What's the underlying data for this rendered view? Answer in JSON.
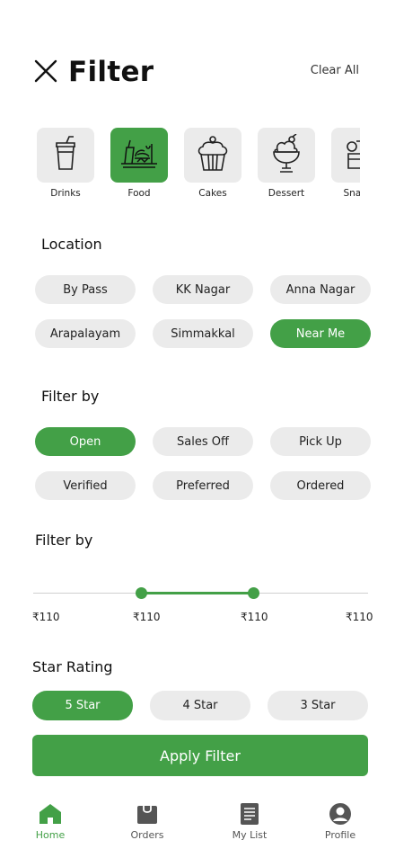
{
  "header": {
    "title": "Filter",
    "clear_all": "Clear All"
  },
  "categories": [
    {
      "label": "Drinks",
      "icon": "cup-icon",
      "active": false
    },
    {
      "label": "Food",
      "icon": "food-icon",
      "active": true
    },
    {
      "label": "Cakes",
      "icon": "cupcake-icon",
      "active": false
    },
    {
      "label": "Dessert",
      "icon": "sundae-icon",
      "active": false
    },
    {
      "label": "Snacks",
      "icon": "snack-icon",
      "active": false
    }
  ],
  "location": {
    "title": "Location",
    "options": [
      "By Pass",
      "KK Nagar",
      "Anna Nagar",
      "Arapalayam",
      "Simmakkal",
      "Near Me"
    ],
    "selected": "Near Me"
  },
  "filter_by": {
    "title": "Filter by",
    "options": [
      "Open",
      "Sales Off",
      "Pick Up",
      "Verified",
      "Preferred",
      "Ordered"
    ],
    "selected": "Open"
  },
  "price": {
    "title": "Filter by",
    "labels": [
      "₹110",
      "₹110",
      "₹110",
      "₹110"
    ]
  },
  "star_rating": {
    "title": "Star Rating",
    "options": [
      "5 Star",
      "4 Star",
      "3 Star"
    ],
    "selected": "5 Star"
  },
  "apply_label": "Apply Filter",
  "tabs": [
    {
      "label": "Home",
      "icon": "home-icon",
      "active": true
    },
    {
      "label": "Orders",
      "icon": "bag-icon",
      "active": false
    },
    {
      "label": "My List",
      "icon": "list-icon",
      "active": false
    },
    {
      "label": "Profile",
      "icon": "profile-icon",
      "active": false
    }
  ],
  "colors": {
    "accent": "#43a047",
    "chip_bg": "#ebebeb"
  }
}
